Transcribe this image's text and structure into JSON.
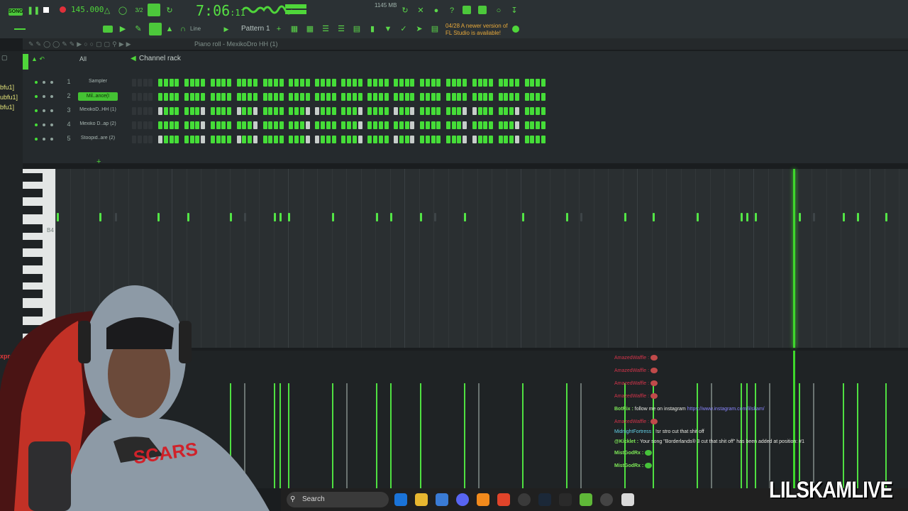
{
  "toolbar": {
    "mode_badge": "SONG",
    "tempo": "145.000",
    "time_main": "7:06",
    "time_sub": "11",
    "memory_value": "1145 MB",
    "memory_label": "",
    "pattern_label": "Pattern 1",
    "snap_mode": "Line",
    "update_line1": "04/28  A newer version of",
    "update_line2": "FL Studio is available!"
  },
  "piano_roll": {
    "title": "Piano roll - MexikoDro HH (1)",
    "key_label": "B4"
  },
  "channel_rack": {
    "filter": "All",
    "title": "Channel rack",
    "channels": [
      {
        "num": "1",
        "name": "Sampler"
      },
      {
        "num": "2",
        "name": "Mil..ance(I"
      },
      {
        "num": "3",
        "name": "MexikoD..HH (1)"
      },
      {
        "num": "4",
        "name": "Mexiko D..ap (2)"
      },
      {
        "num": "5",
        "name": "Stoopid..are (2)"
      }
    ]
  },
  "sidebar": {
    "labels": [
      "bfu1]",
      "ubfu1]",
      "bfu1]"
    ],
    "bottom_red": "xprod",
    "bottom_gray": "Co"
  },
  "chat": {
    "messages": [
      {
        "user": "AmazedWaffle",
        "text": "",
        "style": "red"
      },
      {
        "user": "AmazedWaffle",
        "text": "",
        "style": "red"
      },
      {
        "user": "AmazedWaffle",
        "text": "",
        "style": "red"
      },
      {
        "user": "AmazedWaffle",
        "text": "",
        "style": "red"
      },
      {
        "user": "BotRix",
        "text": "follow me on instagram",
        "link": "https://www.instagram.com/lilskam/",
        "style": "green"
      },
      {
        "user": "AmazedWaffle",
        "text": "",
        "style": "red"
      },
      {
        "user": "MidnightFortress",
        "text": "!sr stro cut that shit off",
        "style": "cyan"
      },
      {
        "user": "@Kicklet",
        "text": "Your song \"Borderlands® 3 cut that shit off\" has been added at position: #1",
        "style": "green"
      },
      {
        "user": "MistGodRx",
        "text": "",
        "style": "green"
      },
      {
        "user": "MistGodRx",
        "text": "",
        "style": "green"
      }
    ]
  },
  "taskbar": {
    "search_label": "Search"
  },
  "watermark": "LILSKAMLIVE",
  "colors": {
    "accent": "#45dd38",
    "background": "#1a1d1f"
  }
}
